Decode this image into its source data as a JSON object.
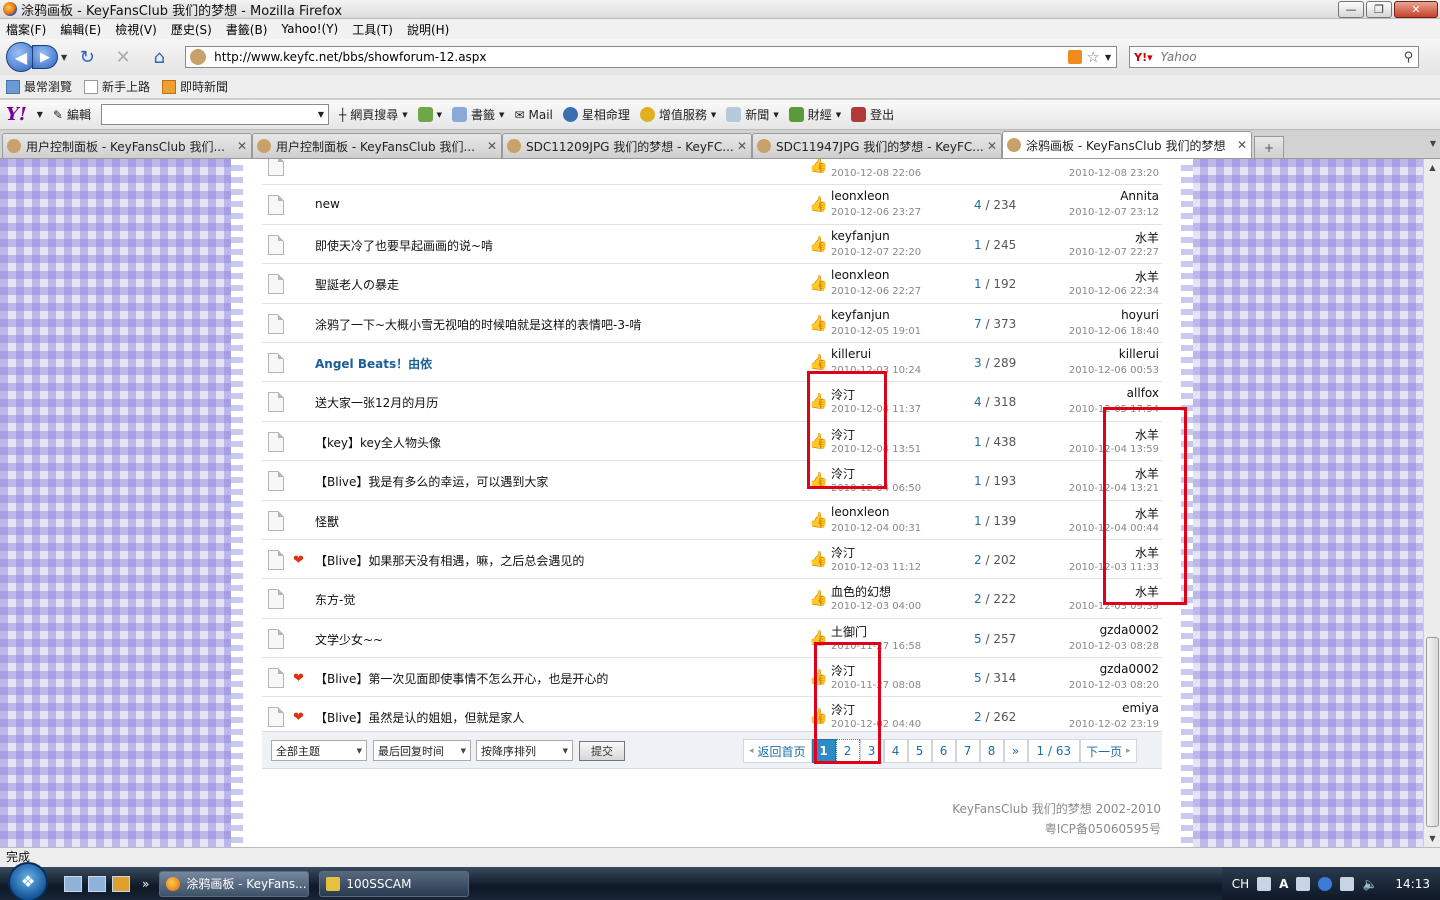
{
  "window": {
    "title": "涂鸦画板 - KeyFansClub 我们的梦想 - Mozilla Firefox"
  },
  "menu": [
    "檔案(F)",
    "編輯(E)",
    "檢視(V)",
    "歷史(S)",
    "書籤(B)",
    "Yahoo!(Y)",
    "工具(T)",
    "說明(H)"
  ],
  "nav": {
    "url": "http://www.keyfc.net/bbs/showforum-12.aspx",
    "search_placeholder": "Yahoo"
  },
  "bookmarks": [
    "最常瀏覽",
    "新手上路",
    "即時新聞"
  ],
  "yahoo_toolbar": {
    "edit_label": "編輯",
    "items": [
      "網頁搜尋",
      "書籤",
      "Mail",
      "星相命理",
      "增值服務",
      "新聞",
      "財經",
      "登出"
    ]
  },
  "tabs": [
    {
      "label": "用户控制面板 - KeyFansClub 我们...",
      "active": false
    },
    {
      "label": "用户控制面板 - KeyFansClub 我们...",
      "active": false
    },
    {
      "label": "SDC11209JPG 我们的梦想 - KeyFC...",
      "active": false
    },
    {
      "label": "SDC11947JPG 我们的梦想 - KeyFC...",
      "active": false
    },
    {
      "label": "涂鸦画板 - KeyFansClub 我们的梦想",
      "active": true
    }
  ],
  "threads": [
    {
      "subject": "",
      "hot": false,
      "special": false,
      "author": "",
      "author_date": "2010-12-08 22:06",
      "replies": "",
      "views": "",
      "last_user": "",
      "last_date": "2010-12-08 23:20"
    },
    {
      "subject": "new",
      "hot": false,
      "special": false,
      "author": "leonxleon",
      "author_date": "2010-12-06 23:27",
      "replies": "4",
      "views": "234",
      "last_user": "Annita",
      "last_date": "2010-12-07 23:12"
    },
    {
      "subject": "即使天冷了也要早起画画的说~啃",
      "hot": false,
      "special": false,
      "author": "keyfanjun",
      "author_date": "2010-12-07 22:20",
      "replies": "1",
      "views": "245",
      "last_user": "水羊",
      "last_date": "2010-12-07 22:27"
    },
    {
      "subject": "聖誕老人の暴走",
      "hot": false,
      "special": false,
      "author": "leonxleon",
      "author_date": "2010-12-06 22:27",
      "replies": "1",
      "views": "192",
      "last_user": "水羊",
      "last_date": "2010-12-06 22:34"
    },
    {
      "subject": "涂鸦了一下~大概小雪无视咱的时候咱就是这样的表情吧-3-啃",
      "hot": false,
      "special": false,
      "author": "keyfanjun",
      "author_date": "2010-12-05 19:01",
      "replies": "7",
      "views": "373",
      "last_user": "hoyuri",
      "last_date": "2010-12-06 18:40"
    },
    {
      "subject": "Angel Beats！由依",
      "hot": false,
      "special": true,
      "author": "killerui",
      "author_date": "2010-12-03 10:24",
      "replies": "3",
      "views": "289",
      "last_user": "killerui",
      "last_date": "2010-12-06 00:53"
    },
    {
      "subject": "送大家一张12月的月历",
      "hot": false,
      "special": false,
      "author": "泠汀",
      "author_date": "2010-12-04 11:37",
      "replies": "4",
      "views": "318",
      "last_user": "allfox",
      "last_date": "2010-12-05 17:54"
    },
    {
      "subject": "【key】key全人物头像",
      "hot": false,
      "special": false,
      "author": "泠汀",
      "author_date": "2010-12-04 13:51",
      "replies": "1",
      "views": "438",
      "last_user": "水羊",
      "last_date": "2010-12-04 13:59"
    },
    {
      "subject": "【Blive】我是有多么的幸运，可以遇到大家",
      "hot": false,
      "special": false,
      "author": "泠汀",
      "author_date": "2010-12-04 06:50",
      "replies": "1",
      "views": "193",
      "last_user": "水羊",
      "last_date": "2010-12-04 13:21"
    },
    {
      "subject": "怪獸",
      "hot": false,
      "special": false,
      "author": "leonxleon",
      "author_date": "2010-12-04 00:31",
      "replies": "1",
      "views": "139",
      "last_user": "水羊",
      "last_date": "2010-12-04 00:44"
    },
    {
      "subject": "【Blive】如果那天没有相遇，嘛，之后总会遇见的",
      "hot": true,
      "special": false,
      "author": "泠汀",
      "author_date": "2010-12-03 11:12",
      "replies": "2",
      "views": "202",
      "last_user": "水羊",
      "last_date": "2010-12-03 11:33"
    },
    {
      "subject": "东方-觉",
      "hot": false,
      "special": false,
      "author": "血色的幻想",
      "author_date": "2010-12-03 04:00",
      "replies": "2",
      "views": "222",
      "last_user": "水羊",
      "last_date": "2010-12-03 09:39"
    },
    {
      "subject": "文学少女~~",
      "hot": false,
      "special": false,
      "author": "土御门",
      "author_date": "2010-11-27 16:58",
      "replies": "5",
      "views": "257",
      "last_user": "gzda0002",
      "last_date": "2010-12-03 08:28"
    },
    {
      "subject": "【Blive】第一次见面即使事情不怎么开心，也是开心的",
      "hot": true,
      "special": false,
      "author": "泠汀",
      "author_date": "2010-11-27 08:08",
      "replies": "5",
      "views": "314",
      "last_user": "gzda0002",
      "last_date": "2010-12-03 08:20"
    },
    {
      "subject": "【Blive】虽然是认的姐姐，但就是家人",
      "hot": true,
      "special": false,
      "author": "泠汀",
      "author_date": "2010-12-02 04:40",
      "replies": "2",
      "views": "262",
      "last_user": "emiya",
      "last_date": "2010-12-02 23:19"
    }
  ],
  "filters": {
    "topic": "全部主题",
    "order_by": "最后回复时间",
    "direction": "按降序排列",
    "submit": "提交"
  },
  "pager": {
    "back_home": "返回首页",
    "pages": [
      "1",
      "2",
      "3",
      "4",
      "5",
      "6",
      "7",
      "8"
    ],
    "current": "1",
    "more": "»",
    "position": "1 / 63",
    "next": "下一页"
  },
  "footer": {
    "line1": "KeyFansClub 我们的梦想 2002-2010",
    "line2": "粤ICP备05060595号"
  },
  "status": "完成",
  "taskbar": {
    "tasks": [
      "涂鸦画板 - KeyFans...",
      "100SSCAM"
    ],
    "lang": "CH",
    "time": "14:13"
  },
  "colors": {
    "highlight": "#e0001a",
    "link_blue": "#1c5e95",
    "pager_current": "#2d8bc8"
  }
}
